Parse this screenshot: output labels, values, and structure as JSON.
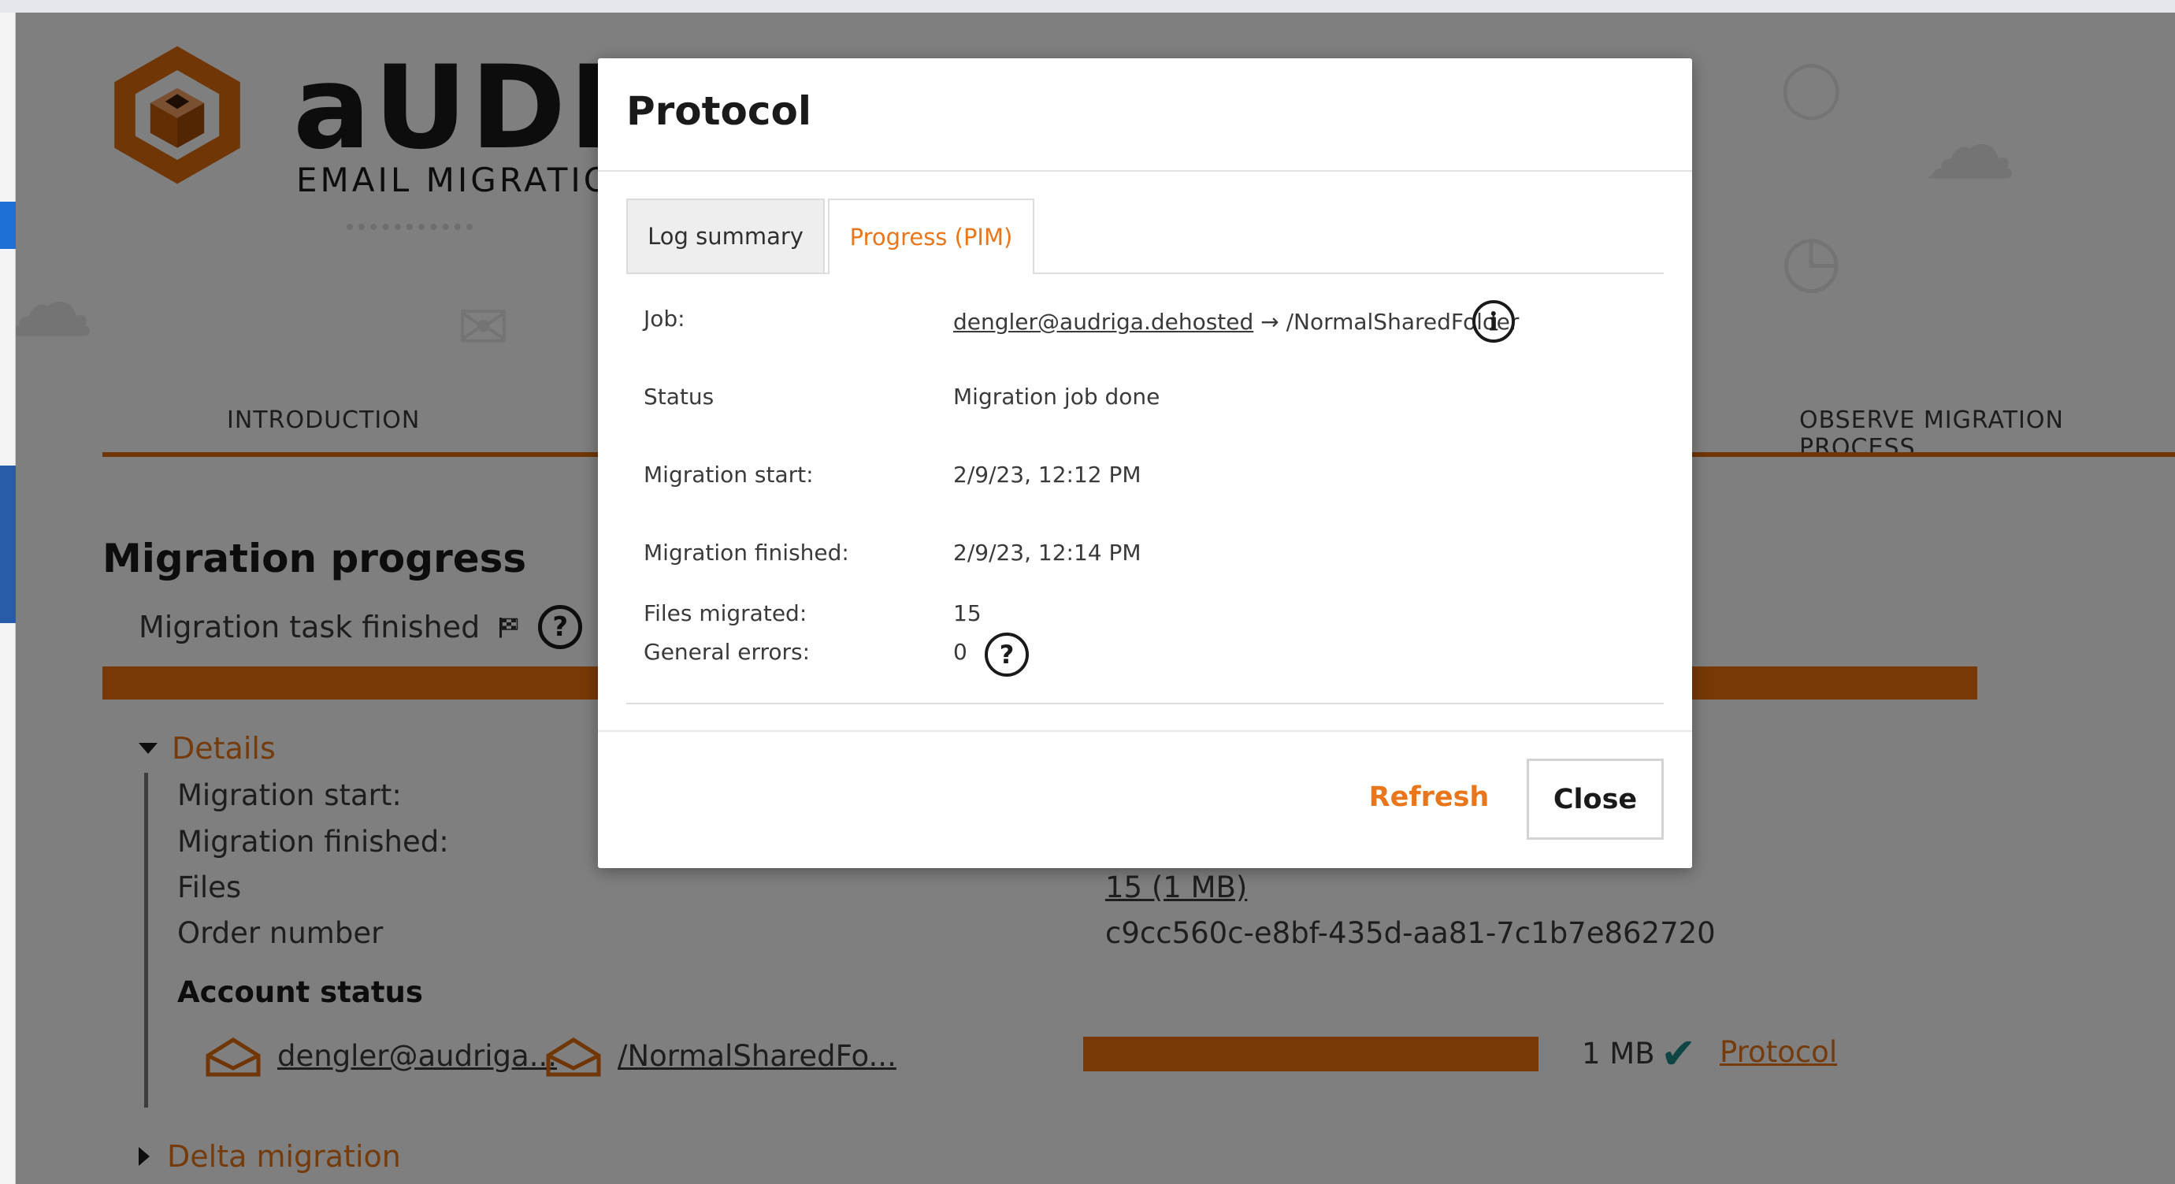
{
  "brand": {
    "name": "aUDR",
    "tagline": "EMAIL MIGRATIO"
  },
  "steps": {
    "introduction": "INTRODUCTION",
    "observe": "OBSERVE MIGRATION PROCESS"
  },
  "progress": {
    "title": "Migration progress",
    "task_status": "Migration task finished",
    "help_glyph": "?",
    "details_label": "Details",
    "details": {
      "start_label": "Migration start:",
      "finished_label": "Migration finished:",
      "files_label": "Files",
      "files_value": "15 (1 MB)",
      "order_label": "Order number",
      "order_value": "c9cc560c-e8bf-435d-aa81-7c1b7e862720"
    },
    "account_status_label": "Account status",
    "account": {
      "source": "dengler@audriga...",
      "target": "/NormalSharedFo...",
      "size": "1 MB",
      "progress_fraction": 1.0,
      "protocol_link": "Protocol"
    },
    "delta_label": "Delta migration"
  },
  "modal": {
    "title": "Protocol",
    "tabs": [
      {
        "label": "Log summary",
        "active": false
      },
      {
        "label": "Progress (PIM)",
        "active": true
      }
    ],
    "rows": {
      "job_label": "Job:",
      "job_source": "dengler@audriga.dehosted",
      "job_arrow": "→",
      "job_target": "/NormalSharedFolder",
      "status_label": "Status",
      "status_value": "Migration job done",
      "start_label": "Migration start:",
      "start_value": "2/9/23, 12:12 PM",
      "finished_label": "Migration finished:",
      "finished_value": "2/9/23, 12:14 PM",
      "files_label": "Files migrated:",
      "files_value": "15",
      "errors_label": "General errors:",
      "errors_value": "0"
    },
    "info_glyph": "i",
    "help_glyph": "?",
    "refresh_label": "Refresh",
    "close_label": "Close"
  },
  "colors": {
    "accent": "#e9761a",
    "progress": "#f0730f",
    "check": "#1f8a86"
  }
}
